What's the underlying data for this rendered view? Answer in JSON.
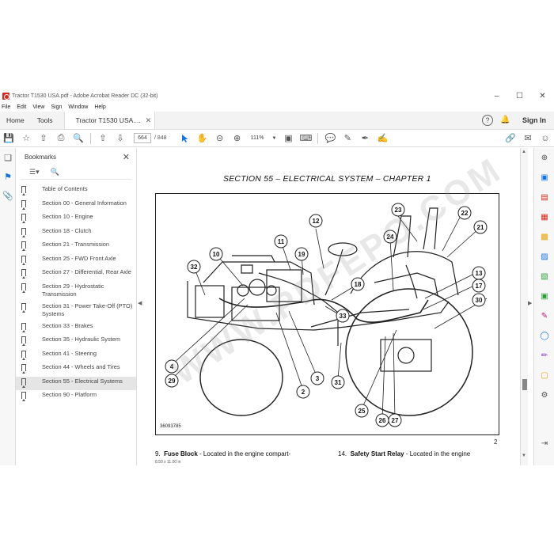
{
  "window": {
    "title": "Tractor T1530 USA.pdf - Adobe Acrobat Reader DC (32-bit)",
    "controls": [
      "–",
      "☐",
      "✕"
    ]
  },
  "menu": [
    "File",
    "Edit",
    "View",
    "Sign",
    "Window",
    "Help"
  ],
  "tabs": {
    "home": "Home",
    "tools": "Tools",
    "document": "Tractor T1530 USA....",
    "close": "✕",
    "help": "?",
    "sign_in": "Sign In"
  },
  "toolbar": {
    "page_current": "664",
    "page_total": "/ 848",
    "zoom": "111%"
  },
  "bookmarks": {
    "header": "Bookmarks",
    "close": "✕",
    "items": [
      "Table of Contents",
      "Section 00 - General Information",
      "Section 10 - Engine",
      "Section 18 - Clutch",
      "Section 21 - Transmission",
      "Section 25 - FWD Front Axle",
      "Section 27 - Differential, Rear Axle",
      "Section 29 - Hydrostatic Transmission",
      "Section 31 - Power Take-Off (PTO) Systems",
      "Section 33 - Brakes",
      "Section 35 - Hydraulic System",
      "Section 41 - Steering",
      "Section 44 - Wheels and Tires",
      "Section 55 - Electrical Systems",
      "Section 90 - Platform"
    ],
    "selected_index": 13
  },
  "page": {
    "section_title": "SECTION 55 – ELECTRICAL SYSTEM – CHAPTER 1",
    "figure_id": "36093785",
    "page_number": "2",
    "left_text_num": "9.",
    "left_text_bold": "Fuse Block",
    "left_text": " -  Located in the engine compart-",
    "right_text_num": "14.",
    "right_text_bold": "Safety Start Relay",
    "right_text": " -  Located in the engine",
    "size_label": "8.50 x 11.00 in",
    "watermark": "WWW.PDFEPO.COM",
    "callouts": [
      "2",
      "3",
      "4",
      "10",
      "11",
      "12",
      "13",
      "17",
      "18",
      "19",
      "21",
      "22",
      "23",
      "24",
      "25",
      "26",
      "27",
      "29",
      "30",
      "31",
      "32",
      "33"
    ]
  },
  "colors": {
    "accent": "#1473e6",
    "acrobat_red": "#d7261d"
  }
}
